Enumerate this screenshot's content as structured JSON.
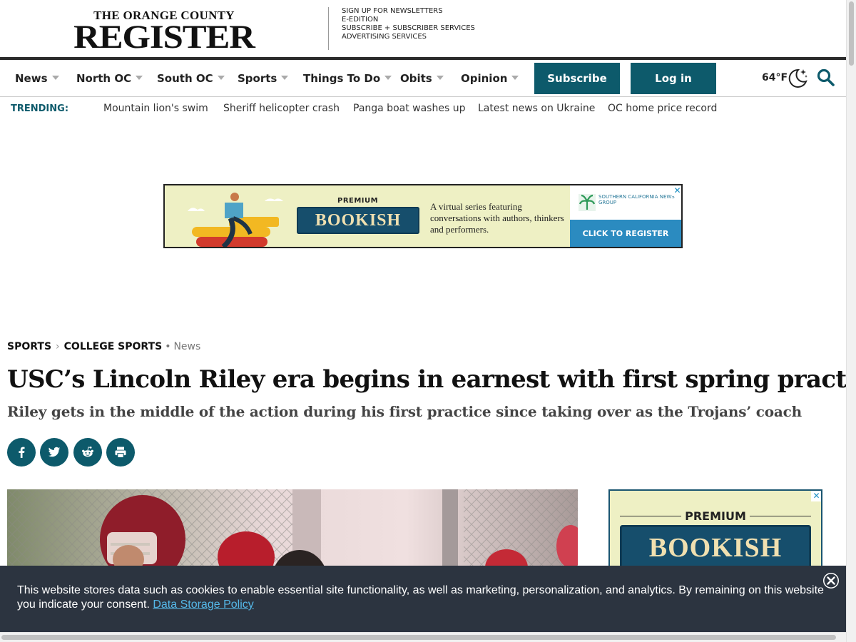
{
  "masthead": {
    "logo_top": "THE ORANGE COUNTY",
    "logo_main": "REGISTER",
    "top_links": [
      "SIGN UP FOR NEWSLETTERS",
      "E-EDITION",
      "SUBSCRIBE + SUBSCRIBER SERVICES",
      "ADVERTISING SERVICES"
    ]
  },
  "nav": {
    "items": [
      "News",
      "North OC",
      "South OC",
      "Sports",
      "Things To Do",
      "Obits",
      "Opinion"
    ],
    "subscribe_label": "Subscribe",
    "login_label": "Log in",
    "temperature": "64°F",
    "weather_icon": "moon-stars-icon",
    "search_icon": "search-icon"
  },
  "trending": {
    "label": "TRENDING:",
    "links": [
      "Mountain lion's swim",
      "Sheriff helicopter crash",
      "Panga boat washes up",
      "Latest news on Ukraine",
      "OC home price record"
    ]
  },
  "ad_banner": {
    "premium": "PREMIUM",
    "title": "BOOKISH",
    "copy": "A virtual series featuring conversations with authors, thinkers and performers.",
    "sponsor": "SOUTHERN CALIFORNIA NEWS GROUP",
    "cta": "CLICK TO REGISTER",
    "close": "✕"
  },
  "article": {
    "breadcrumb": [
      "SPORTS",
      "COLLEGE SPORTS"
    ],
    "category": "News",
    "headline": "USC’s Lincoln Riley era begins in earnest with first spring practice",
    "subhead": "Riley gets in the middle of the action during his first practice since taking over as the Trojans’ coach",
    "share_icons": [
      "facebook-icon",
      "twitter-icon",
      "reddit-icon",
      "print-icon"
    ]
  },
  "side_ad": {
    "premium": "PREMIUM",
    "title": "BOOKISH",
    "close": "✕"
  },
  "cookie": {
    "text": "This website stores data such as cookies to enable essential site functionality, as well as marketing, personalization, and analytics. By remaining on this website you indicate your consent.",
    "link": "Data Storage Policy"
  },
  "colors": {
    "brand_teal": "#0d5a6b",
    "cookie_bg": "#2c3440",
    "link_blue": "#55b8e8"
  }
}
